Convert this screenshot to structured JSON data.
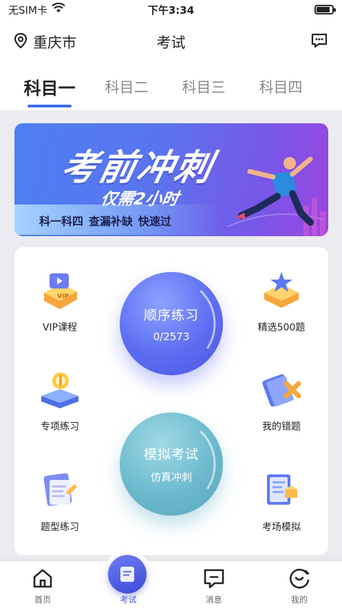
{
  "status_bar": {
    "carrier": "无SIM卡",
    "time": "下午3:34",
    "battery_level": 0.85
  },
  "header": {
    "city": "重庆市",
    "title": "考试"
  },
  "tabs": [
    {
      "label": "科目一",
      "active": true
    },
    {
      "label": "科目二",
      "active": false
    },
    {
      "label": "科目三",
      "active": false
    },
    {
      "label": "科目四",
      "active": false
    }
  ],
  "banner": {
    "title": "考前冲刺",
    "subtitle": "仅需2小时",
    "slogan": [
      "科一科四",
      "查漏补缺",
      "快速过"
    ]
  },
  "practice": {
    "left": [
      {
        "label": "VIP课程",
        "icon": "vip-course-icon"
      },
      {
        "label": "专项练习",
        "icon": "special-practice-icon"
      },
      {
        "label": "题型练习",
        "icon": "question-type-icon"
      }
    ],
    "right": [
      {
        "label": "精选500题",
        "icon": "star-500-icon"
      },
      {
        "label": "我的错题",
        "icon": "wrong-questions-icon"
      },
      {
        "label": "考场模拟",
        "icon": "exam-room-icon"
      }
    ],
    "sequential": {
      "title": "顺序练习",
      "progress": "0/2573"
    },
    "mock": {
      "title": "模拟考试",
      "subtitle": "仿真冲刺"
    }
  },
  "bottom_nav": [
    {
      "label": "首页",
      "icon": "home-icon",
      "active": false
    },
    {
      "label": "考试",
      "icon": "exam-icon",
      "active": true
    },
    {
      "label": "消息",
      "icon": "message-icon",
      "active": false
    },
    {
      "label": "我的",
      "icon": "profile-icon",
      "active": false
    }
  ],
  "colors": {
    "accent": "#3c6cf0",
    "circle_blue": "#5d6df2",
    "circle_teal": "#6cb9cd"
  }
}
